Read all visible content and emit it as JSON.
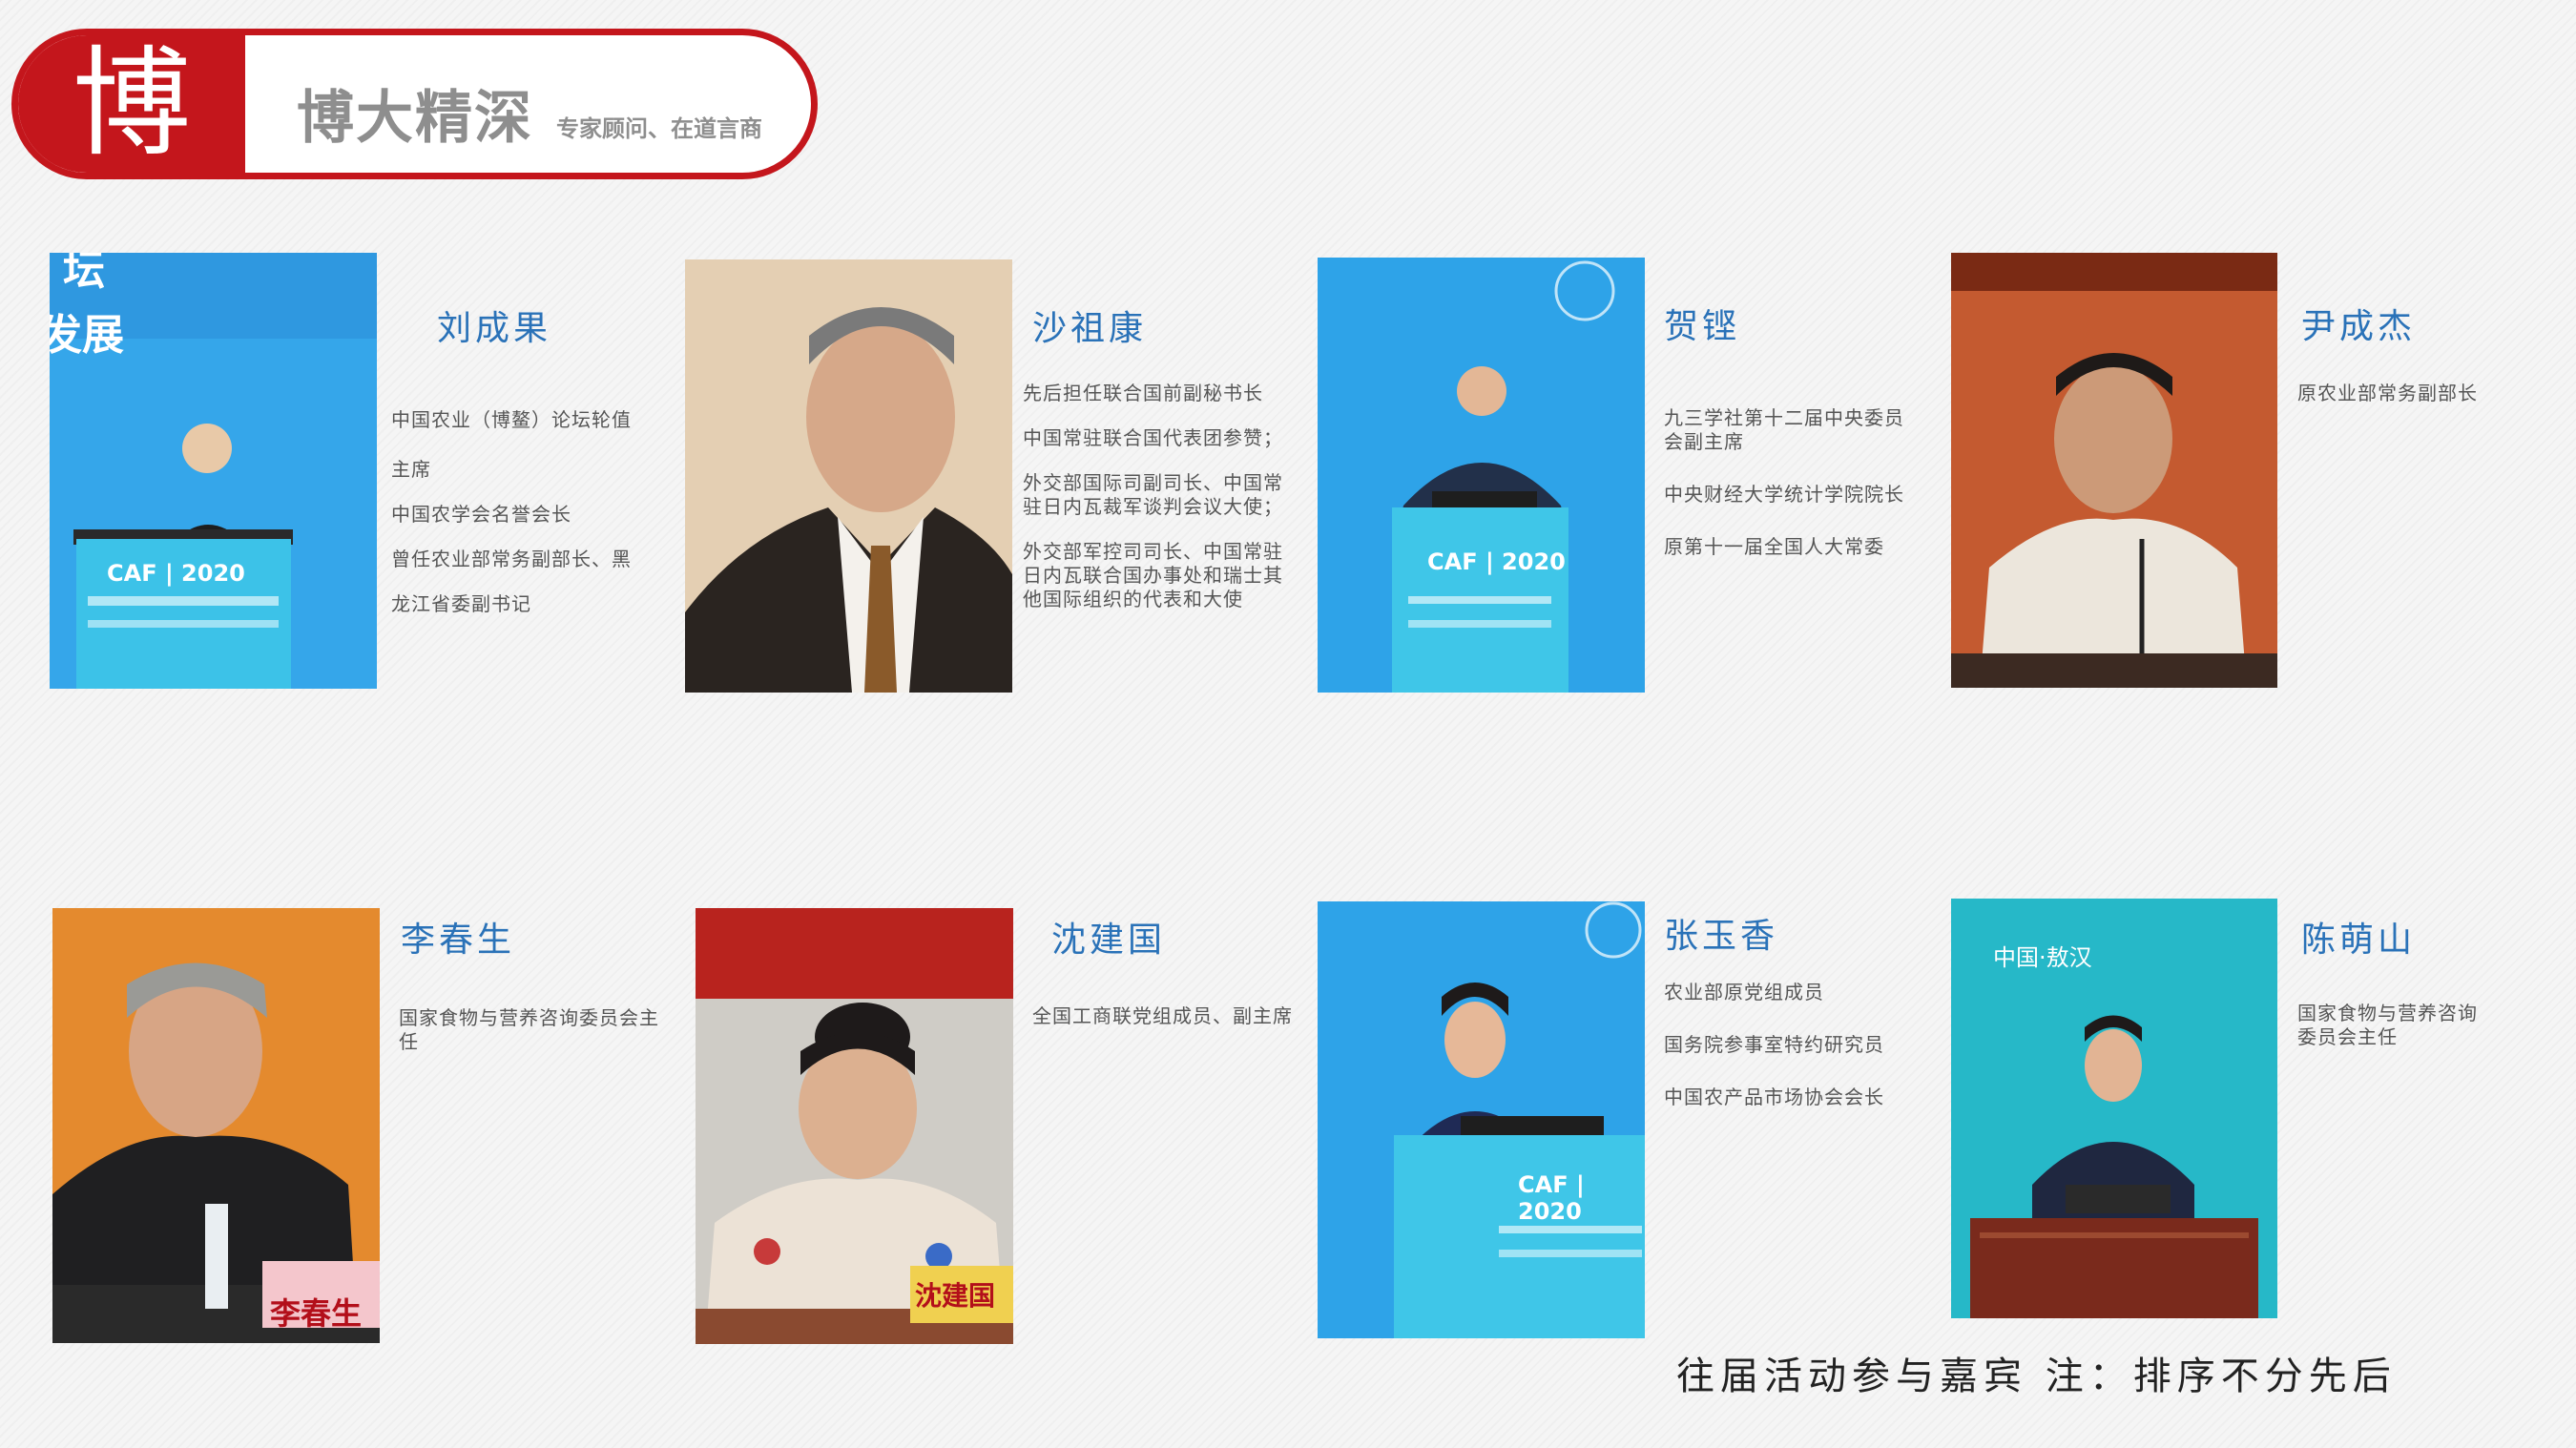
{
  "header": {
    "badge_char": "博",
    "title": "博大精深",
    "subtitle": "专家顾问、在道言商"
  },
  "colors": {
    "accent": "#c4161c",
    "name": "#2a72b8"
  },
  "photos": {
    "p1_text": "CAF | 2020",
    "p1_side": "坛",
    "p1_side2": "发展",
    "p3_text": "CAF | 2020",
    "p7_text": "CAF | 2020",
    "p5_tag": "李春生",
    "p6_tag": "沈建国",
    "p8_sign": "中国·敖汉"
  },
  "guests": [
    {
      "name": "刘成果",
      "lines": [
        "中国农业（博鳌）论坛轮值",
        "主席",
        "中国农学会名誉会长",
        "曾任农业部常务副部长、黑",
        "龙江省委副书记"
      ]
    },
    {
      "name": "沙祖康",
      "lines": [
        "先后担任联合国前副秘书长",
        "中国常驻联合国代表团参赞；",
        "外交部国际司副司长、中国常驻日内瓦裁军谈判会议大使；",
        "外交部军控司司长、中国常驻日内瓦联合国办事处和瑞士其他国际组织的代表和大使"
      ]
    },
    {
      "name": "贺铿",
      "lines": [
        "九三学社第十二届中央委员会副主席",
        "中央财经大学统计学院院长",
        "原第十一届全国人大常委"
      ]
    },
    {
      "name": "尹成杰",
      "lines": [
        "原农业部常务副部长"
      ]
    },
    {
      "name": "李春生",
      "lines": [
        "国家食物与营养咨询委员会主任"
      ]
    },
    {
      "name": "沈建国",
      "lines": [
        "全国工商联党组成员、副主席"
      ]
    },
    {
      "name": "张玉香",
      "lines": [
        "农业部原党组成员",
        "国务院参事室特约研究员",
        "中国农产品市场协会会长"
      ]
    },
    {
      "name": "陈萌山",
      "lines": [
        "国家食物与营养咨询委员会主任"
      ]
    }
  ],
  "footnote": "往届活动参与嘉宾 注：排序不分先后"
}
